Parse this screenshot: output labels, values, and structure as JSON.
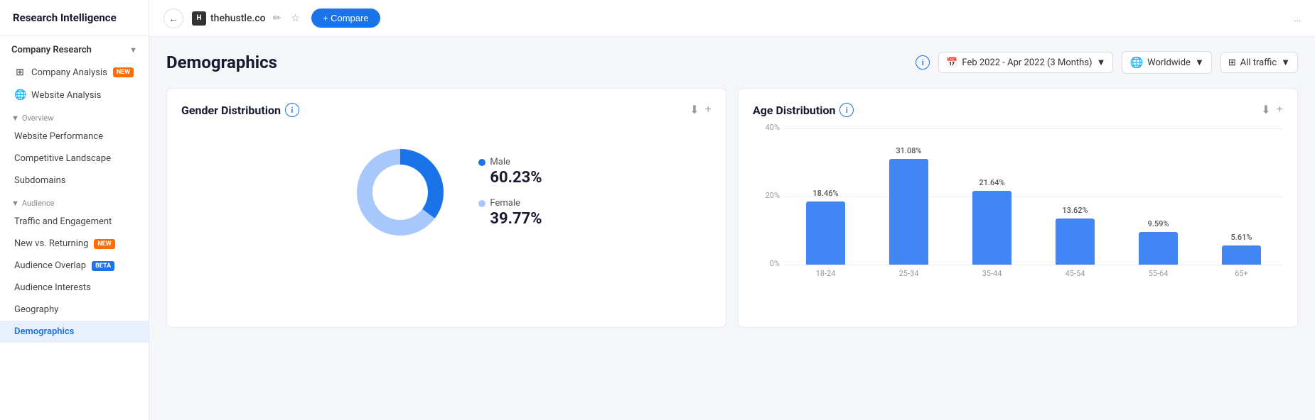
{
  "app": {
    "title": "Research Intelligence"
  },
  "topbar": {
    "domain": "thehustle.co",
    "compare_label": "+ Compare",
    "extra_icon": "..."
  },
  "sidebar": {
    "sections": [
      {
        "id": "company-research",
        "label": "Company Research",
        "expanded": true,
        "items": [
          {
            "id": "company-analysis",
            "label": "Company Analysis",
            "badge": "NEW",
            "badge_type": "new",
            "active": false
          },
          {
            "id": "website-analysis",
            "label": "Website Analysis",
            "badge": null,
            "active": false
          }
        ]
      }
    ],
    "overview_label": "Overview",
    "overview_items": [
      {
        "id": "website-performance",
        "label": "Website Performance",
        "active": false
      },
      {
        "id": "competitive-landscape",
        "label": "Competitive Landscape",
        "active": false
      },
      {
        "id": "subdomains",
        "label": "Subdomains",
        "active": false
      }
    ],
    "audience_label": "Audience",
    "audience_items": [
      {
        "id": "traffic-engagement",
        "label": "Traffic and Engagement",
        "active": false
      },
      {
        "id": "new-vs-returning",
        "label": "New vs. Returning",
        "badge": "NEW",
        "badge_type": "new",
        "active": false
      },
      {
        "id": "audience-overlap",
        "label": "Audience Overlap",
        "badge": "BETA",
        "badge_type": "beta",
        "active": false
      },
      {
        "id": "audience-interests",
        "label": "Audience Interests",
        "active": false
      },
      {
        "id": "geography",
        "label": "Geography",
        "active": false
      },
      {
        "id": "demographics",
        "label": "Demographics",
        "active": true
      }
    ]
  },
  "page": {
    "title": "Demographics",
    "date_range": "Feb 2022 - Apr 2022 (3 Months)",
    "region": "Worldwide",
    "traffic": "All traffic"
  },
  "gender_chart": {
    "title": "Gender Distribution",
    "male_label": "Male",
    "male_pct": "60.23%",
    "female_label": "Female",
    "female_pct": "39.77%",
    "male_color": "#1a73e8",
    "female_color": "#a8c7fa",
    "male_value": 60.23,
    "female_value": 39.77
  },
  "age_chart": {
    "title": "Age Distribution",
    "y_labels": [
      "40%",
      "20%",
      "0%"
    ],
    "bars": [
      {
        "label": "18-24",
        "value": 18.46,
        "display": "18.46%"
      },
      {
        "label": "25-34",
        "value": 31.08,
        "display": "31.08%"
      },
      {
        "label": "35-44",
        "value": 21.64,
        "display": "21.64%"
      },
      {
        "label": "45-54",
        "value": 13.62,
        "display": "13.62%"
      },
      {
        "label": "55-64",
        "value": 9.59,
        "display": "9.59%"
      },
      {
        "label": "65+",
        "value": 5.61,
        "display": "5.61%"
      }
    ],
    "max_value": 40,
    "bar_color": "#4285f4"
  }
}
